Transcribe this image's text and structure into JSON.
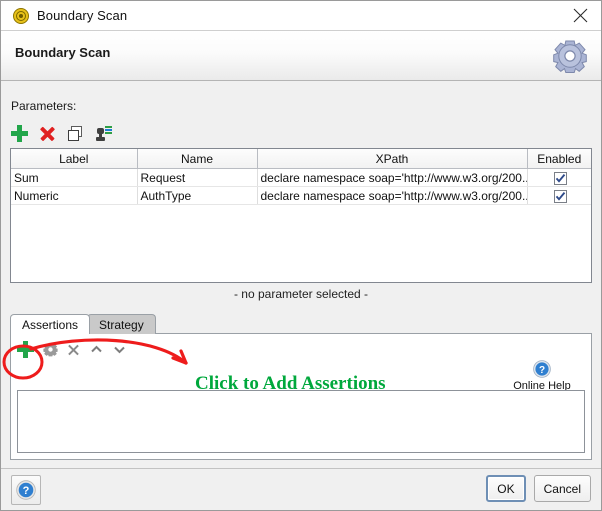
{
  "window": {
    "title": "Boundary Scan",
    "title_icon": "target-icon",
    "close_icon": "close-icon"
  },
  "header": {
    "title": "Boundary Scan",
    "gear_icon": "gear-icon"
  },
  "parameters": {
    "label": "Parameters:",
    "toolbar": [
      {
        "name": "add-parameter-button",
        "icon": "plus-icon"
      },
      {
        "name": "delete-parameter-button",
        "icon": "red-x-icon"
      },
      {
        "name": "duplicate-parameter-button",
        "icon": "copy-icon"
      },
      {
        "name": "import-parameter-button",
        "icon": "import-icon"
      }
    ],
    "columns": [
      "Label",
      "Name",
      "XPath",
      "Enabled"
    ],
    "rows": [
      {
        "label": "Sum",
        "name": "Request",
        "xpath": "declare namespace soap='http://www.w3.org/200...",
        "enabled": true
      },
      {
        "label": "Numeric",
        "name": "AuthType",
        "xpath": "declare namespace soap='http://www.w3.org/200...",
        "enabled": true
      }
    ],
    "empty_selection": "- no parameter selected -"
  },
  "tabs": [
    {
      "label": "Assertions",
      "active": true
    },
    {
      "label": "Strategy",
      "active": false
    }
  ],
  "assertions": {
    "toolbar": [
      {
        "name": "add-assertion-button",
        "icon": "plus-icon"
      },
      {
        "name": "configure-assertion-button",
        "icon": "gear-icon"
      },
      {
        "name": "remove-assertion-button",
        "icon": "close-x-icon"
      },
      {
        "name": "move-assertion-up-button",
        "icon": "chevron-up-icon"
      },
      {
        "name": "move-assertion-down-button",
        "icon": "chevron-down-icon"
      }
    ],
    "online_help": {
      "label": "Online Help",
      "icon": "help-circle-icon"
    },
    "list_items": []
  },
  "annotation": {
    "text": "Click to Add Assertions",
    "text_color": "#00a83c",
    "mark_color": "#ee1c1c",
    "shapes": [
      "ellipse-highlight",
      "curved-arrow"
    ]
  },
  "footer": {
    "help_icon": "help-circle-icon",
    "ok_label": "OK",
    "cancel_label": "Cancel"
  },
  "colors": {
    "window_bg": "#f0f0f0",
    "panel_bg": "#ffffff",
    "accent_green": "#22a64a",
    "accent_red": "#e02020",
    "annotation_red": "#ee1c1c",
    "annotation_green": "#00a83c",
    "title_icon_gold": "#e8c21a"
  }
}
